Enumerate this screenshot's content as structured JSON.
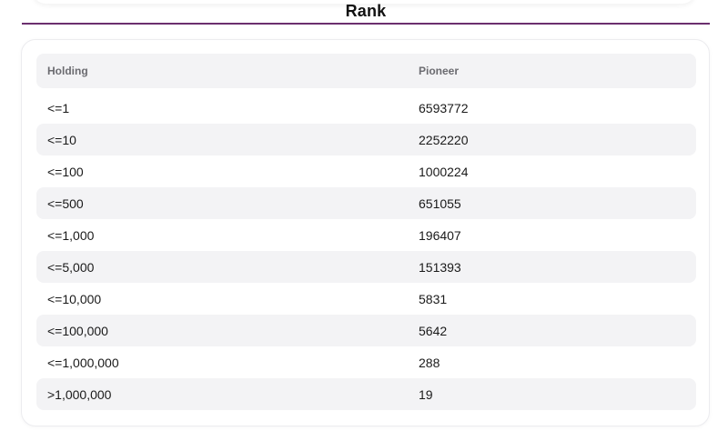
{
  "section": {
    "title": "Rank"
  },
  "table": {
    "headers": {
      "holding": "Holding",
      "pioneer": "Pioneer"
    },
    "rows": [
      {
        "holding": "<=1",
        "pioneer": "6593772"
      },
      {
        "holding": "<=10",
        "pioneer": "2252220"
      },
      {
        "holding": "<=100",
        "pioneer": "1000224"
      },
      {
        "holding": "<=500",
        "pioneer": "651055"
      },
      {
        "holding": "<=1,000",
        "pioneer": "196407"
      },
      {
        "holding": "<=5,000",
        "pioneer": "151393"
      },
      {
        "holding": "<=10,000",
        "pioneer": "5831"
      },
      {
        "holding": "<=100,000",
        "pioneer": "5642"
      },
      {
        "holding": "<=1,000,000",
        "pioneer": "288"
      },
      {
        "holding": ">1,000,000",
        "pioneer": "19"
      }
    ]
  },
  "colors": {
    "accent_divider": "#6b2f6e",
    "stripe": "#f3f3f5",
    "header_text": "#6b6b70"
  }
}
